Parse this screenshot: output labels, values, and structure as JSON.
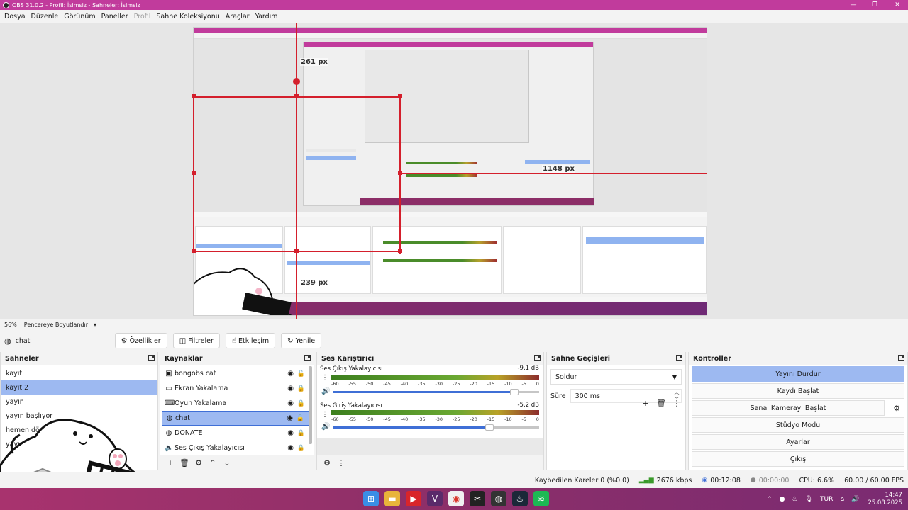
{
  "window": {
    "title": "OBS 31.0.2 - Profil: İsimsiz - Sahneler: İsimsiz",
    "controls": [
      "—",
      "❐",
      "✕"
    ]
  },
  "menu": [
    "Dosya",
    "Düzenle",
    "Görünüm",
    "Paneller",
    "Profil",
    "Sahne Koleksiyonu",
    "Araçlar",
    "Yardım"
  ],
  "preview": {
    "measurements": [
      "261 px",
      "1148 px",
      "239 px"
    ],
    "zoom": "56%",
    "scale_mode": "Pencereye Boyutlandır"
  },
  "source_toolbar": {
    "current_source": "chat",
    "buttons": [
      "Özellikler",
      "Filtreler",
      "Etkileşim",
      "Yenile"
    ]
  },
  "docks": {
    "scenes": {
      "title": "Sahneler",
      "items": [
        "kayıt",
        "kayıt 2",
        "yayın",
        "yayın başlıyor",
        "hemen dönücek",
        "yayın sonlanı"
      ],
      "selected_index": 1
    },
    "sources": {
      "title": "Kaynaklar",
      "items": [
        {
          "name": "bongobs cat",
          "icon": "image-icon",
          "locked": false
        },
        {
          "name": "Ekran Yakalama",
          "icon": "monitor-icon",
          "locked": true
        },
        {
          "name": "Oyun Yakalama",
          "icon": "gamepad-icon",
          "locked": true
        },
        {
          "name": "chat",
          "icon": "browser-icon",
          "locked": false
        },
        {
          "name": "DONATE",
          "icon": "browser-icon",
          "locked": true
        },
        {
          "name": "Ses Çıkış Yakalayıcısı",
          "icon": "speaker-icon",
          "locked": true
        }
      ],
      "selected_index": 3
    },
    "mixer": {
      "title": "Ses Karıştırıcı",
      "ticks": [
        "-60",
        "-55",
        "-50",
        "-45",
        "-40",
        "-35",
        "-30",
        "-25",
        "-20",
        "-15",
        "-10",
        "-5",
        "0"
      ],
      "channels": [
        {
          "name": "Ses Çıkış Yakalayıcısı",
          "db": "-9.1 dB",
          "volume": 0.88
        },
        {
          "name": "Ses Giriş Yakalayıcısı",
          "db": "-5.2 dB",
          "volume": 0.76
        }
      ]
    },
    "transitions": {
      "title": "Sahne Geçişleri",
      "selected": "Soldur",
      "duration_label": "Süre",
      "duration": "300 ms"
    },
    "controls": {
      "title": "Kontroller",
      "buttons": [
        "Yayını Durdur",
        "Kaydı Başlat",
        "Sanal Kamerayı Başlat",
        "Stüdyo Modu",
        "Ayarlar",
        "Çıkış"
      ]
    }
  },
  "status": {
    "dropped_frames": "Kaybedilen Kareler 0 (%0.0)",
    "bitrate": "2676 kbps",
    "stream_time": "00:12:08",
    "record_time": "00:00:00",
    "cpu": "CPU: 6.6%",
    "fps": "60.00 / 60.00 FPS"
  },
  "taskbar": {
    "language": "TUR",
    "time": "14:47",
    "date": "25.08.2025"
  },
  "colors": {
    "accent": "#c13b9c",
    "selection": "#9db9f1",
    "measure": "#d41f2c"
  }
}
